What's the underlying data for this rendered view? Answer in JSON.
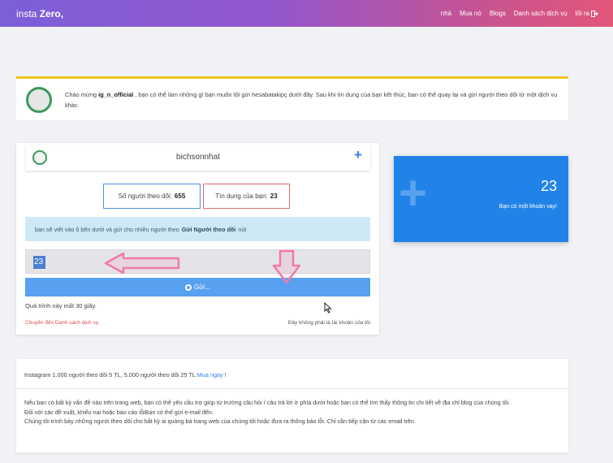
{
  "navbar": {
    "brand_prefix": "insta ",
    "brand_bold": "Zero,",
    "links": [
      "nhà",
      "Mua nó",
      "Blogs",
      "Danh sách dịch vụ"
    ],
    "logout": "lối ra"
  },
  "welcome": {
    "before": "Chào mừng ",
    "username": "ig_n_official",
    "after": " , bạn có thể làm những gì bạn muốn tôi gửi hesabatakipç dưới đây. Sau khi tín dụng của bạn kết thúc, bạn có thể quay lại và gửi người theo dõi từ một dịch vụ khác."
  },
  "panel": {
    "target_username": "bichsonnhat",
    "followers_label": "Số người theo dõi:",
    "followers_value": "655",
    "credit_label": "Tín dụng của bạn:",
    "credit_value": "23",
    "info_before": "bạn sẽ viết vào ô bên dưới và gửi cho nhiều người theo",
    "info_bold": "Gửi Người theo dõi",
    "info_after": "nút",
    "quantity_value": "23",
    "submit_label": "Gửi...",
    "process_note": "Quá trình này mất 30 giây.",
    "services_link": "Chuyển đến Danh sách dịch vụ",
    "not_you_link": "Đây không phải là tài khoản của tôi"
  },
  "loan": {
    "amount": "23",
    "text": "Bạn có một khoản vay!"
  },
  "footer": {
    "promo_text": "Instagram 1.000 người theo dõi 5 TL, 5.000 người theo dõi 25 TL",
    "promo_link": "Mua ngay",
    "promo_suffix": " !",
    "notes": [
      "Nếu bạn có bất kỳ vấn đề nào trên trang web, bạn có thể yêu cầu trợ giúp từ trường câu hỏi / câu trả lời ở phía dưới hoặc bạn có thể tìm thấy thông tin chi tiết về địa chỉ blog của chúng tôi.",
      "Đối với các đề xuất, khiếu nại hoặc báo cáo lỗiBạn có thể gửi e-mail đến.",
      "Chúng tôi trình bày những người theo dõi cho bất kỳ ai quảng bá trang web của chúng tôi hoặc đưa ra thông báo lỗi. Chỉ cần tiếp cận từ các email trên."
    ]
  },
  "colors": {
    "navbar_gradient": [
      "#7b5fd9",
      "#e25778"
    ],
    "welcome_accent": "#f0c419",
    "loan_card": "#2183e8",
    "submit_button": "#58a0f0",
    "annotation_arrows": "#f07aa8"
  },
  "icons": [
    "logout-icon",
    "add-icon",
    "spinner-icon"
  ]
}
